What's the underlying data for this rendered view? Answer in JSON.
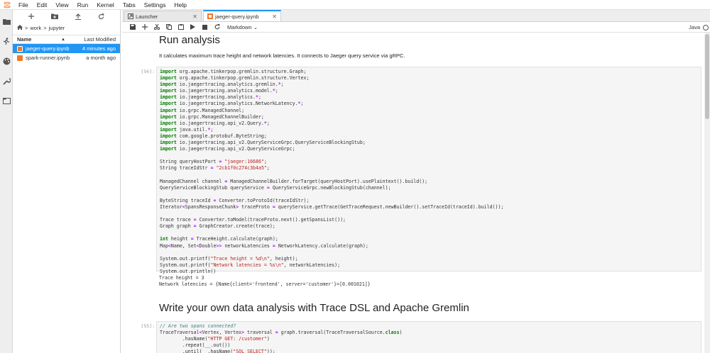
{
  "menu": [
    "File",
    "Edit",
    "View",
    "Run",
    "Kernel",
    "Tabs",
    "Settings",
    "Help"
  ],
  "activity_icons": [
    "folder-icon",
    "running-icon",
    "palette-icon",
    "wrench-icon",
    "tabs-icon"
  ],
  "filebrowser": {
    "toolbar_icons": [
      "plus-icon",
      "new-folder-icon",
      "upload-icon",
      "refresh-icon"
    ],
    "breadcrumb": {
      "sep1": ">",
      "seg1": "work",
      "sep2": ">",
      "seg2": "jupyter"
    },
    "header": {
      "name": "Name",
      "sort_indicator": "▲",
      "modified": "Last Modified"
    },
    "files": [
      {
        "name": "jaeger-query.ipynb",
        "modified": "4 minutes ago",
        "selected": true,
        "icon_color": "#f37726"
      },
      {
        "name": "spark-runner.ipynb",
        "modified": "a month ago",
        "selected": false,
        "icon_color": "#f37726"
      }
    ]
  },
  "tabs": [
    {
      "label": "Launcher",
      "active": false
    },
    {
      "label": "jaeger-query.ipynb",
      "active": true
    }
  ],
  "notebook_toolbar": {
    "cell_type": "Markdown",
    "kernel": "Java"
  },
  "notebook": {
    "heading1": "Run analysis",
    "paragraph1": "It calculates maximum trace height and network latencies. It connects to Jaeger query service via gRPC.",
    "prompt1": "[56]:",
    "output1": "Trace height = 3\nNetwork latencies = {Name{client='frontend', server='customer'}=[0.001021]}",
    "heading2": "Write your own data analysis with Trace DSL and Apache Gremlin",
    "prompt2": "[55]:"
  },
  "accent_color": "#2196f3"
}
